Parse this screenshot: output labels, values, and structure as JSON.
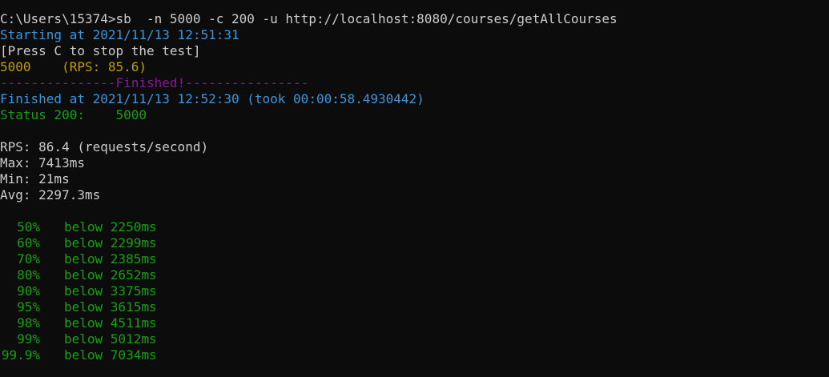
{
  "terminal": {
    "command_line": "C:\\Users\\15374>sb  -n 5000 -c 200 -u http://localhost:8080/courses/getAllCourses",
    "starting": "Starting at 2021/11/13 12:51:31",
    "press_c": "[Press C to stop the test]",
    "progress": "5000    (RPS: 85.6)",
    "finished_banner": "---------------Finished!----------------",
    "finished_at": "Finished at 2021/11/13 12:52:30 (took 00:00:58.4930442)",
    "status": "Status 200:    5000",
    "rps": "RPS: 86.4 (requests/second)",
    "max": "Max: 7413ms",
    "min": "Min: 21ms",
    "avg": "Avg: 2297.3ms",
    "percentiles": [
      {
        "pct": "50%",
        "text": "below 2250ms"
      },
      {
        "pct": "60%",
        "text": "below 2299ms"
      },
      {
        "pct": "70%",
        "text": "below 2385ms"
      },
      {
        "pct": "80%",
        "text": "below 2652ms"
      },
      {
        "pct": "90%",
        "text": "below 3375ms"
      },
      {
        "pct": "95%",
        "text": "below 3615ms"
      },
      {
        "pct": "98%",
        "text": "below 4511ms"
      },
      {
        "pct": "99%",
        "text": "below 5012ms"
      },
      {
        "pct": "99.9%",
        "text": "below 7034ms"
      }
    ]
  },
  "colors": {
    "background": "#0c0c0c",
    "white": "#cccccc",
    "blue": "#3a96dd",
    "yellow": "#c19c00",
    "magenta": "#881798",
    "green": "#13a10e"
  }
}
